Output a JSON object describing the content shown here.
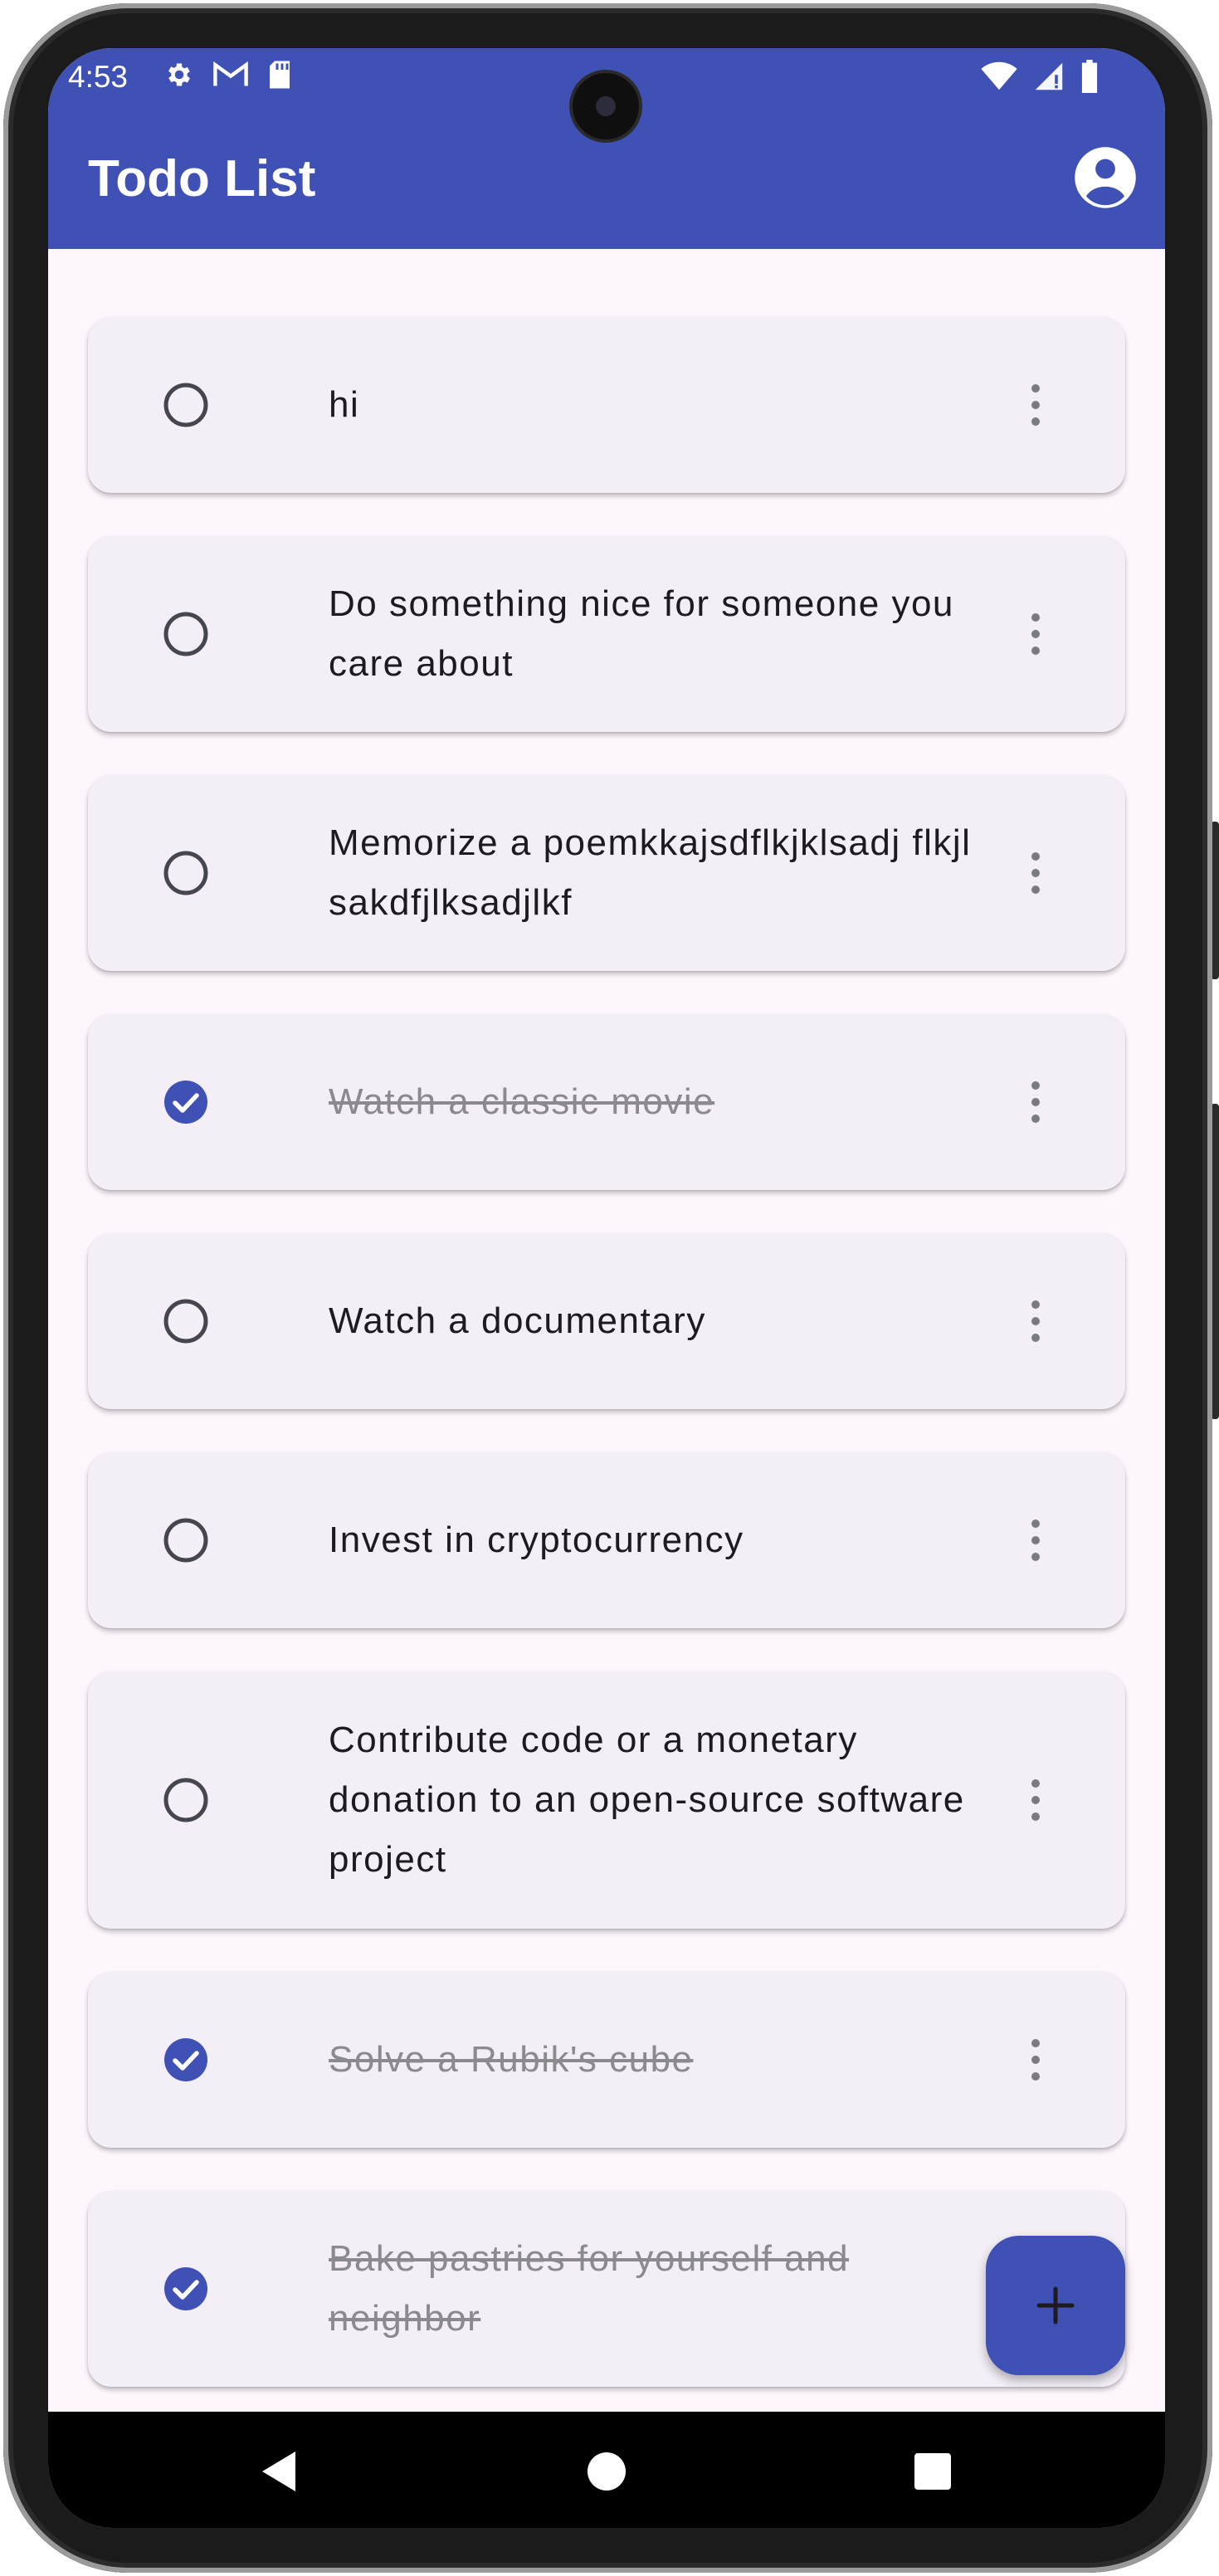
{
  "status_bar": {
    "time": "4:53",
    "left_icons": [
      "settings-icon",
      "gmail-icon",
      "sd-card-icon"
    ],
    "right_icons": [
      "wifi-icon",
      "signal-icon",
      "battery-icon"
    ]
  },
  "app_bar": {
    "title": "Todo List",
    "account_icon": "account-circle-icon"
  },
  "colors": {
    "primary": "#3f51b5",
    "background": "#fdf7fd",
    "card": "#f4eef6",
    "text": "#1d1b20",
    "done_text": "#8b8a8e"
  },
  "todos": [
    {
      "text": "hi",
      "completed": false
    },
    {
      "text": "Do something nice for someone you care about",
      "completed": false
    },
    {
      "text": "Memorize a poemkkajsdflkjklsadj flkjlsakdfjlksadjlkf",
      "completed": false
    },
    {
      "text": "Watch a classic movie",
      "completed": true
    },
    {
      "text": "Watch a documentary",
      "completed": false
    },
    {
      "text": "Invest in cryptocurrency",
      "completed": false
    },
    {
      "text": "Contribute code or a monetary donation to an open-source software project",
      "completed": false
    },
    {
      "text": "Solve a Rubik's cube",
      "completed": true
    },
    {
      "text": "Bake pastries for yourself and neighbor",
      "completed": true
    }
  ],
  "fab": {
    "icon": "plus-icon"
  },
  "nav_bar": {
    "buttons": [
      "back-icon",
      "home-icon",
      "recents-icon"
    ]
  }
}
